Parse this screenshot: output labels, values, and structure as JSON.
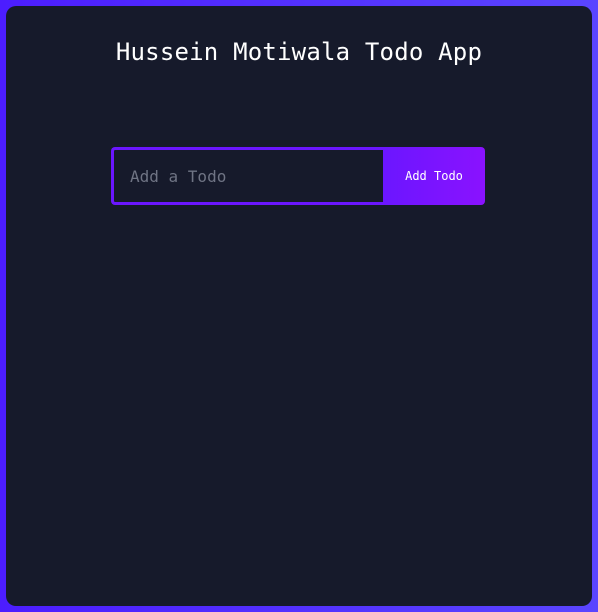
{
  "app": {
    "title": "Hussein Motiwala Todo App"
  },
  "todo_form": {
    "input_value": "",
    "placeholder": "Add a Todo",
    "button_label": "Add Todo"
  },
  "todos": [],
  "colors": {
    "page_background_start": "#4c1dff",
    "page_background_end": "#5a45ff",
    "panel_background": "#161a2b",
    "accent_purple": "#6b16ff",
    "button_gradient_end": "#8a12ff",
    "title_text": "#ffffff",
    "placeholder_text": "#6f7484"
  }
}
